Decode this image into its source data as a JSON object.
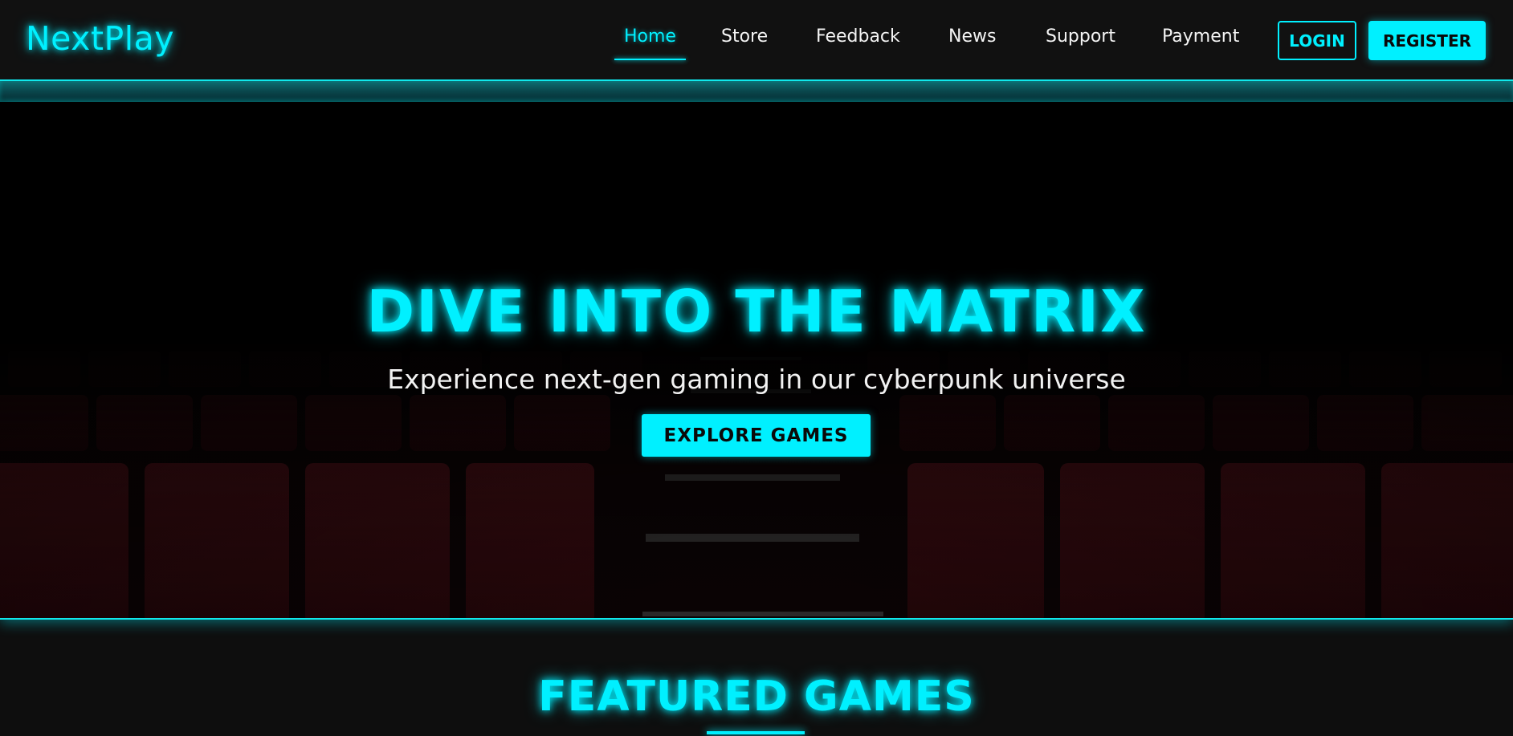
{
  "brand": {
    "name": "NextPlay"
  },
  "nav": {
    "items": [
      {
        "label": "Home",
        "active": true
      },
      {
        "label": "Store",
        "active": false
      },
      {
        "label": "Feedback",
        "active": false
      },
      {
        "label": "News",
        "active": false
      },
      {
        "label": "Support",
        "active": false
      },
      {
        "label": "Payment",
        "active": false
      }
    ],
    "login_label": "LOGIN",
    "register_label": "REGISTER"
  },
  "hero": {
    "title": "DIVE INTO THE MATRIX",
    "subtitle": "Experience next-gen gaming in our cyberpunk universe",
    "cta_label": "EXPLORE GAMES",
    "background": "theater-seats-image"
  },
  "featured": {
    "title": "FEATURED GAMES"
  },
  "colors": {
    "accent": "#00f0ff",
    "header_bg": "#111111",
    "page_bg": "#0e0e0e",
    "seat_red": "#3a0b0f"
  }
}
